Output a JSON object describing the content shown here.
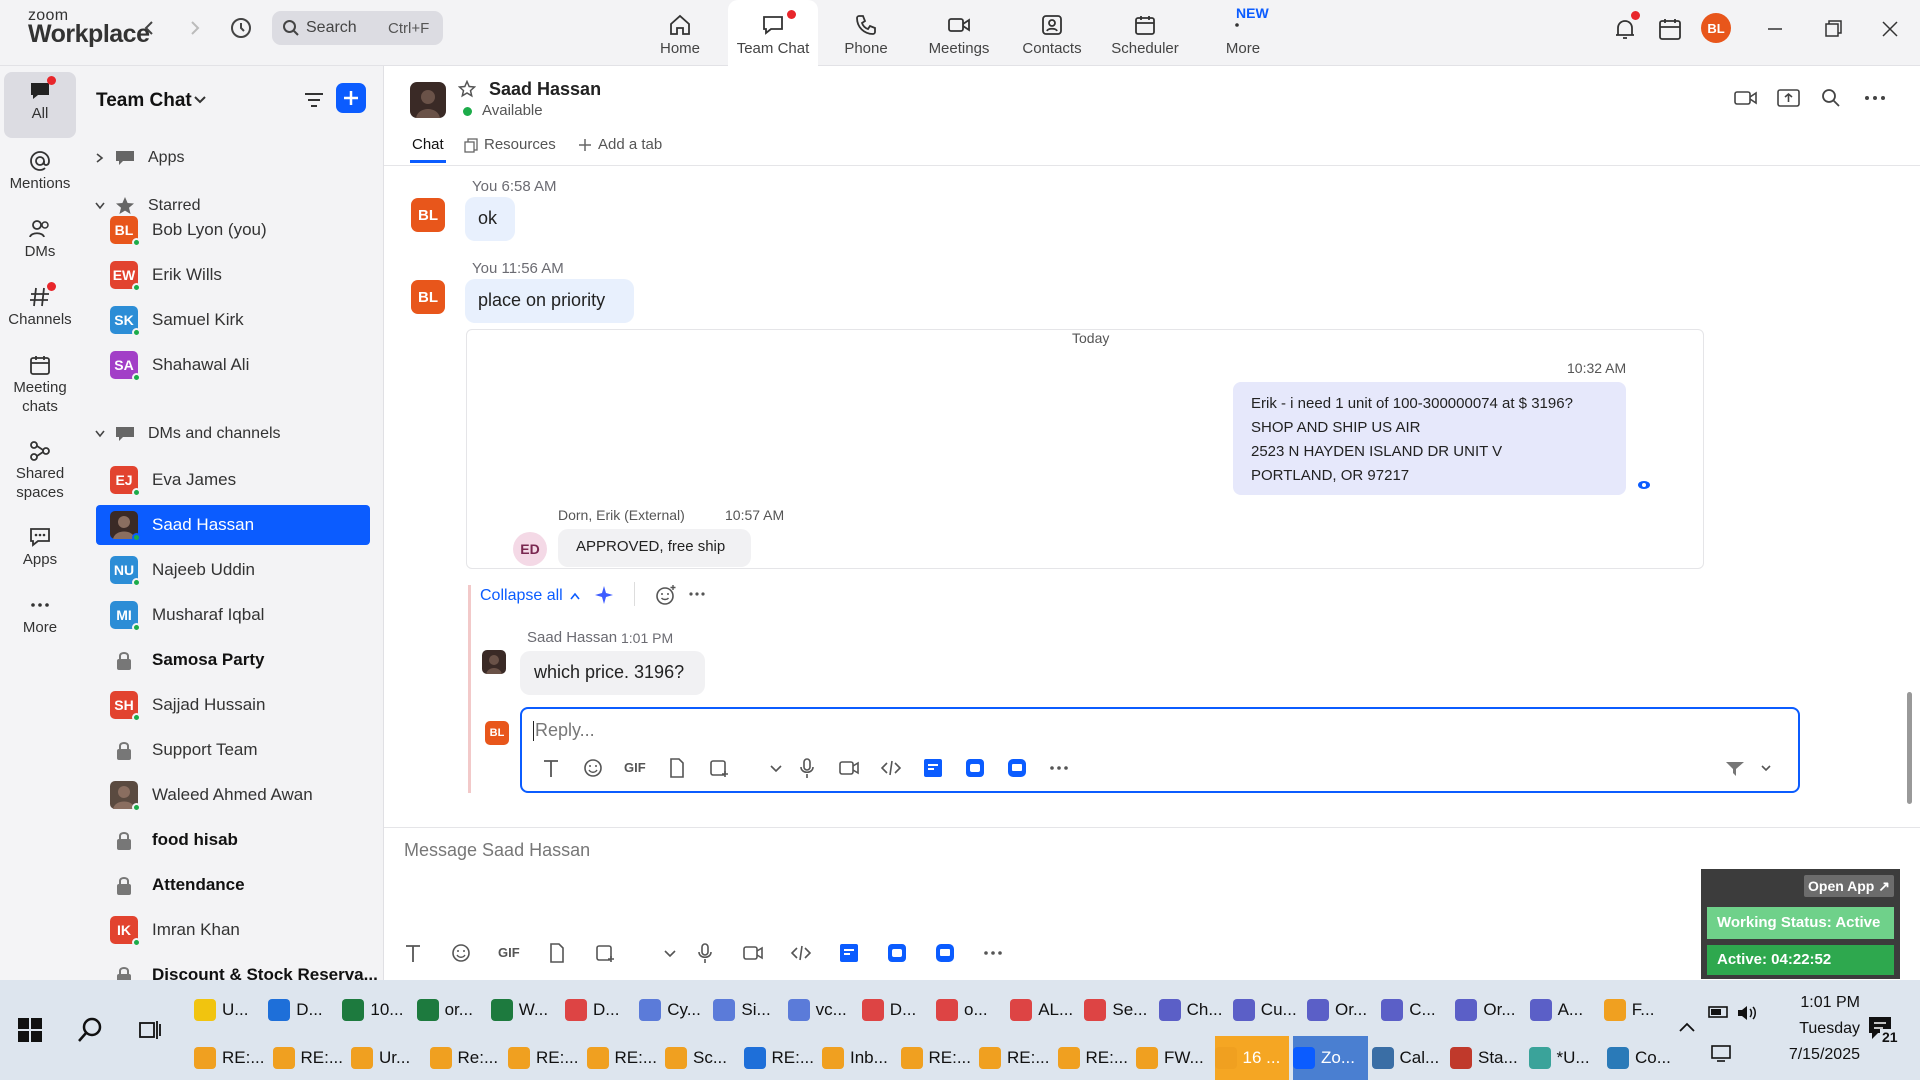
{
  "app": {
    "logo_top": "zoom",
    "logo_bottom": "Workplace"
  },
  "search": {
    "label": "Search",
    "shortcut": "Ctrl+F"
  },
  "nav": [
    {
      "label": "Home"
    },
    {
      "label": "Team Chat"
    },
    {
      "label": "Phone"
    },
    {
      "label": "Meetings"
    },
    {
      "label": "Contacts"
    },
    {
      "label": "Scheduler"
    },
    {
      "label": "More",
      "badge": "NEW"
    }
  ],
  "user_avatar": "BL",
  "rail": [
    {
      "label": "All"
    },
    {
      "label": "Mentions"
    },
    {
      "label": "DMs"
    },
    {
      "label": "Channels"
    },
    {
      "label": "Meeting chats"
    },
    {
      "label": "Shared spaces"
    },
    {
      "label": "Apps"
    },
    {
      "label": "More"
    }
  ],
  "sidebar": {
    "title": "Team Chat",
    "sections": {
      "apps": "Apps",
      "starred": "Starred",
      "dms": "DMs and channels"
    },
    "starred": [
      {
        "initials": "BL",
        "name": "Bob Lyon (you)",
        "color": "#e8561b"
      },
      {
        "initials": "EW",
        "name": "Erik Wills",
        "color": "#e2432f"
      },
      {
        "initials": "SK",
        "name": "Samuel Kirk",
        "color": "#2c8dd6"
      },
      {
        "initials": "SA",
        "name": "Shahawal Ali",
        "color": "#a23fc7"
      }
    ],
    "dms": [
      {
        "initials": "EJ",
        "name": "Eva James",
        "color": "#e2432f"
      },
      {
        "initials": "",
        "name": "Saad Hassan",
        "color": "#3a2a26"
      },
      {
        "initials": "NU",
        "name": "Najeeb Uddin",
        "color": "#2c8dd6"
      },
      {
        "initials": "MI",
        "name": "Musharaf Iqbal",
        "color": "#2c8dd6"
      },
      {
        "initials": "",
        "name": "Samosa Party",
        "color": "#9a9aa2"
      },
      {
        "initials": "SH",
        "name": "Sajjad Hussain",
        "color": "#e2432f"
      },
      {
        "initials": "",
        "name": "Support Team",
        "color": "#9a9aa2"
      },
      {
        "initials": "",
        "name": "Waleed Ahmed Awan",
        "color": "#5a4a40"
      },
      {
        "initials": "",
        "name": "food hisab",
        "color": "#9a9aa2"
      },
      {
        "initials": "",
        "name": "Attendance",
        "color": "#9a9aa2"
      },
      {
        "initials": "IK",
        "name": "Imran Khan",
        "color": "#e2432f"
      },
      {
        "initials": "",
        "name": "Discount & Stock Reserva...",
        "color": "#9a9aa2"
      }
    ]
  },
  "chat": {
    "contact_name": "Saad Hassan",
    "status": "Available",
    "tabs": [
      "Chat",
      "Resources",
      "Add a tab"
    ],
    "messages": [
      {
        "meta": "You 6:58 AM",
        "text": "ok",
        "avatar": "BL"
      },
      {
        "meta": "You 11:56 AM",
        "text": "place on priority",
        "avatar": "BL"
      }
    ],
    "quoted": {
      "day": "Today",
      "time": "10:32 AM",
      "lines": [
        "Erik  -  i need 1 unit of 100-300000074 at $ 3196?",
        "SHOP AND SHIP US AIR",
        "2523 N HAYDEN ISLAND DR UNIT V",
        "PORTLAND, OR 97217"
      ],
      "reply_sender": "Dorn, Erik (External)",
      "reply_time": "10:57 AM",
      "reply_avatar": "ED",
      "reply_text": "APPROVED, free ship"
    },
    "collapse_label": "Collapse all",
    "thread_reply": {
      "sender": "Saad Hassan",
      "time": "1:01 PM",
      "text": "which price. 3196?"
    },
    "reply_placeholder": "Reply...",
    "compose_placeholder": "Message Saad Hassan",
    "gif": "GIF"
  },
  "widget": {
    "open_app": "Open App ↗",
    "working": "Working Status: Active",
    "active": "Active: 04:22:52"
  },
  "taskbar": {
    "time": "1:01 PM",
    "day": "Tuesday",
    "date": "7/15/2025",
    "notif_count": "21",
    "row1": [
      "U...",
      "D...",
      "10...",
      "or...",
      "W...",
      "D...",
      "Cy...",
      "Si...",
      "vc...",
      "D...",
      "o...",
      "AL...",
      "Se...",
      "Ch...",
      "Cu...",
      "Or...",
      "C...",
      "Or...",
      "A...",
      "F..."
    ],
    "row2": [
      "RE:...",
      "RE:...",
      "Ur...",
      "Re:...",
      "RE:...",
      "RE:...",
      "Sc...",
      "RE:...",
      "Inb...",
      "RE:...",
      "RE:...",
      "RE:...",
      "FW...",
      "16 ...",
      "Zo...",
      "Cal...",
      "Sta...",
      "*U...",
      "Co..."
    ]
  }
}
